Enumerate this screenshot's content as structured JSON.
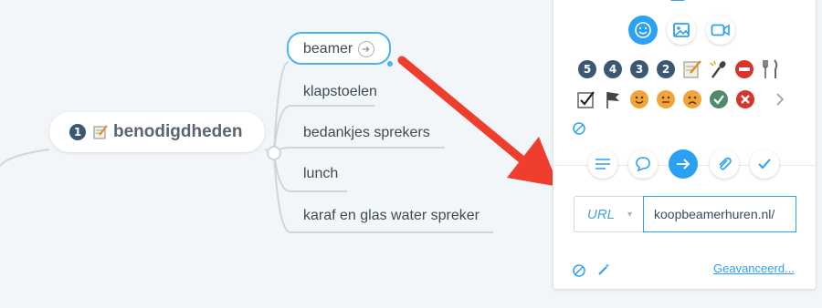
{
  "mindmap": {
    "central_topic": {
      "number": "1",
      "label": "benodigdheden",
      "icon": "memo-icon"
    },
    "subtopics": [
      {
        "label": "beamer",
        "selected": true,
        "has_link": true
      },
      {
        "label": "klapstoelen"
      },
      {
        "label": "bedankjes sprekers"
      },
      {
        "label": "lunch"
      },
      {
        "label": "karaf en glas water spreker"
      }
    ]
  },
  "panel": {
    "tabs": [
      {
        "name": "emoji-tab",
        "icon": "smiley-icon",
        "active": true
      },
      {
        "name": "image-tab",
        "icon": "image-icon"
      },
      {
        "name": "video-tab",
        "icon": "video-icon"
      }
    ],
    "icon_rows": [
      [
        "5",
        "4",
        "3",
        "2",
        "memo",
        "microphone",
        "no-entry",
        "fork-knife"
      ],
      [
        "checkbox",
        "flag",
        "smile",
        "neutral",
        "frown",
        "check",
        "cross",
        "chevron-right"
      ]
    ],
    "sections": [
      {
        "name": "notes-section",
        "icon": "lines-icon"
      },
      {
        "name": "comment-section",
        "icon": "speech-bubble-icon"
      },
      {
        "name": "link-section",
        "icon": "arrow-right-icon",
        "active": true
      },
      {
        "name": "attachment-section",
        "icon": "paperclip-icon"
      },
      {
        "name": "task-section",
        "icon": "checkmark-icon"
      }
    ],
    "link_type": "URL",
    "link_value": "koopbeamerhuren.nl/",
    "advanced_label": "Geavanceerd..."
  },
  "colors": {
    "accent": "#2aa1f3",
    "arrow": "#ef3e2e",
    "selection_border": "#4ab3f4"
  }
}
